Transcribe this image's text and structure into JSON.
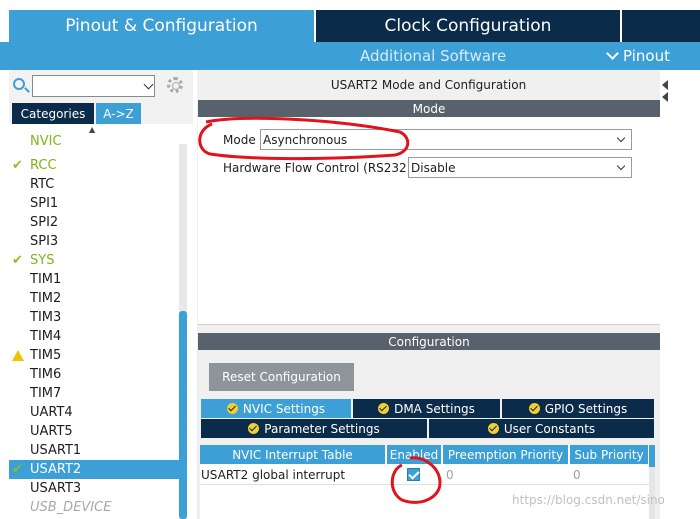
{
  "header": {
    "tabs": [
      {
        "label": "Pinout & Configuration",
        "active": true
      },
      {
        "label": "Clock Configuration",
        "active": false
      }
    ],
    "subbar": {
      "additional_software": "Additional Software",
      "pinout": "Pinout"
    }
  },
  "sidebar": {
    "search": {
      "value": "",
      "placeholder": ""
    },
    "view_tabs": [
      "Categories",
      "A->Z"
    ],
    "items": [
      {
        "label": "NVIC",
        "state": "green-partial"
      },
      {
        "label": "RCC",
        "state": "checked"
      },
      {
        "label": "RTC",
        "state": "normal"
      },
      {
        "label": "SPI1",
        "state": "normal"
      },
      {
        "label": "SPI2",
        "state": "normal"
      },
      {
        "label": "SPI3",
        "state": "normal"
      },
      {
        "label": "SYS",
        "state": "checked"
      },
      {
        "label": "TIM1",
        "state": "normal"
      },
      {
        "label": "TIM2",
        "state": "normal"
      },
      {
        "label": "TIM3",
        "state": "normal"
      },
      {
        "label": "TIM4",
        "state": "normal"
      },
      {
        "label": "TIM5",
        "state": "warning"
      },
      {
        "label": "TIM6",
        "state": "normal"
      },
      {
        "label": "TIM7",
        "state": "normal"
      },
      {
        "label": "UART4",
        "state": "normal"
      },
      {
        "label": "UART5",
        "state": "normal"
      },
      {
        "label": "USART1",
        "state": "normal"
      },
      {
        "label": "USART2",
        "state": "selected-checked"
      },
      {
        "label": "USART3",
        "state": "normal"
      },
      {
        "label": "USB_DEVICE",
        "state": "disabled"
      }
    ]
  },
  "main": {
    "title": "USART2 Mode and Configuration",
    "mode_section": {
      "header": "Mode",
      "mode_label": "Mode",
      "mode_value": "Asynchronous",
      "flow_label": "Hardware Flow Control (RS232)",
      "flow_value": "Disable"
    },
    "config_section": {
      "header": "Configuration",
      "reset_button": "Reset Configuration",
      "tabs": [
        {
          "label": "NVIC Settings",
          "active": true
        },
        {
          "label": "DMA Settings",
          "active": false
        },
        {
          "label": "GPIO Settings",
          "active": false
        },
        {
          "label": "Parameter Settings",
          "active": false
        },
        {
          "label": "User Constants",
          "active": false
        }
      ],
      "table": {
        "columns": [
          "NVIC Interrupt Table",
          "Enabled",
          "Preemption Priority",
          "Sub Priority"
        ],
        "rows": [
          {
            "name": "USART2 global interrupt",
            "enabled": true,
            "preemption": "0",
            "sub": "0"
          }
        ]
      }
    }
  },
  "watermark": "https://blog.csdn.net/sino",
  "colors": {
    "accent": "#3c9fd6",
    "dark": "#0a2c4a",
    "section_bar": "#58626c",
    "check_green": "#8dbf1e",
    "annotation": "#e0141e"
  }
}
